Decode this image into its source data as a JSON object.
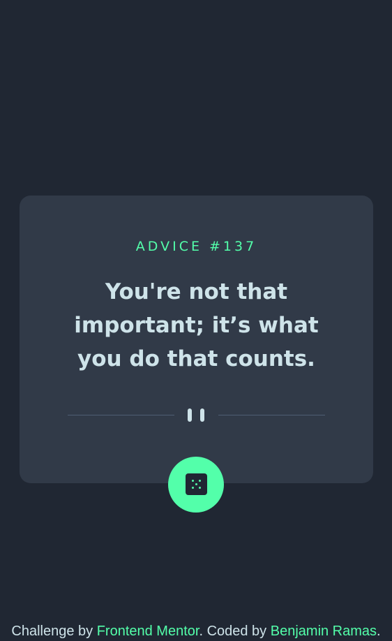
{
  "advice": {
    "label": "ADVICE #137",
    "text_lines": [
      "You're not that",
      "important; it’s what",
      "you do that counts."
    ]
  },
  "controls": {
    "pause_icon": "pause-icon",
    "dice_icon": "dice-icon"
  },
  "footer": {
    "prefix": "Challenge by ",
    "link1": "Frontend Mentor",
    "middle": ". Coded by ",
    "link2": "Benjamin Ramas",
    "suffix": "."
  },
  "colors": {
    "background": "#202733",
    "card": "#313a48",
    "accent": "#53ffaa",
    "text": "#cee3e9",
    "divider": "#4f5d74"
  }
}
